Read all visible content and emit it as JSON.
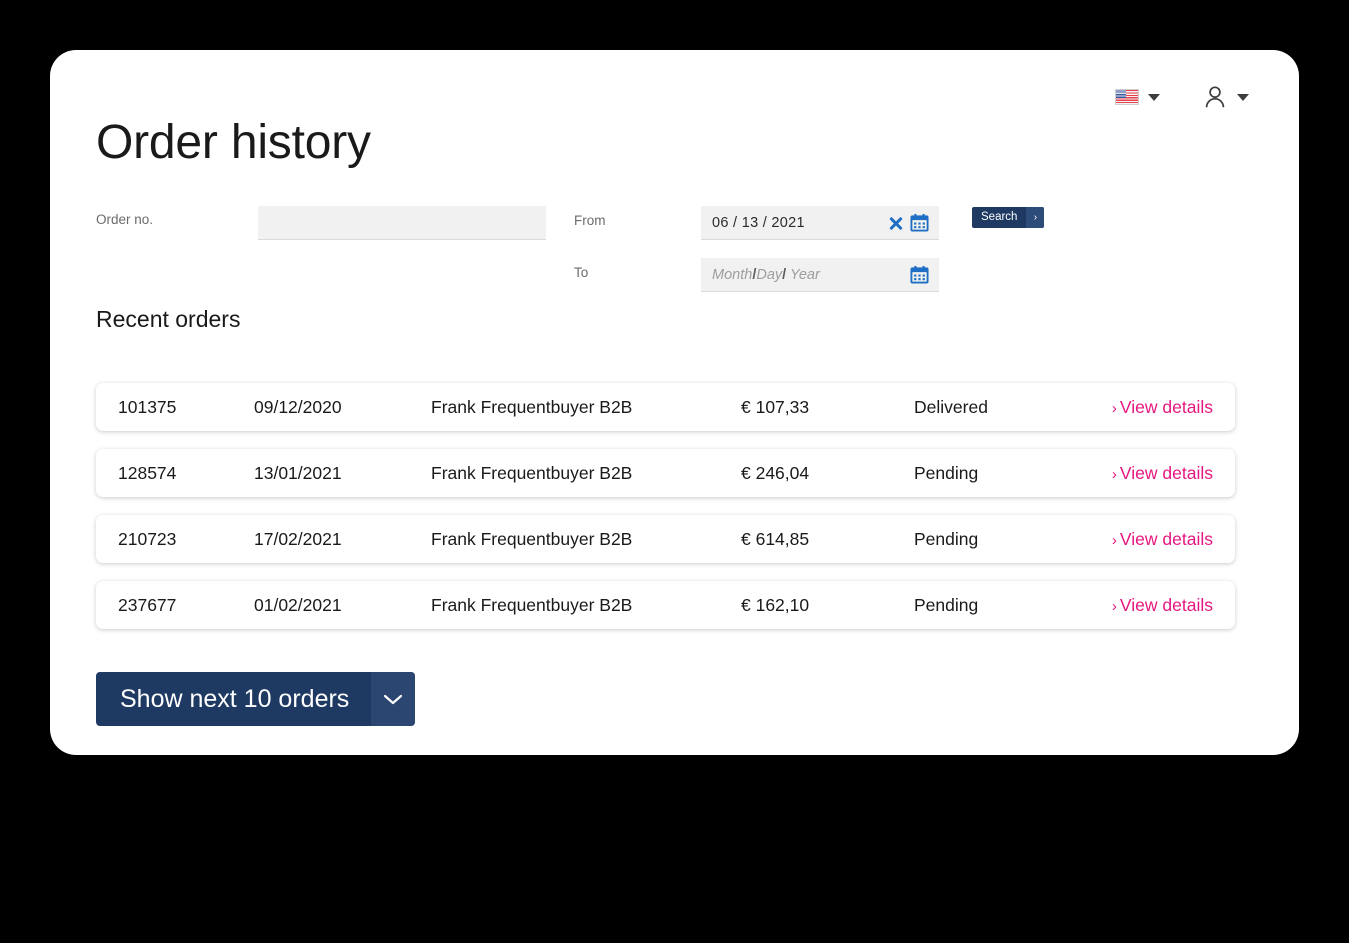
{
  "header": {
    "language_flag": "us-flag-icon",
    "language_caret": "chevron-down-icon",
    "account_icon": "user-icon",
    "account_caret": "chevron-down-icon"
  },
  "page_title": "Order history",
  "search_form": {
    "order_no_label": "Order no.",
    "order_no_value": "",
    "order_no_placeholder": "",
    "from_label": "From",
    "from_value": "06 / 13 / 2021",
    "from_clear_icon": "close-icon",
    "from_calendar_icon": "calendar-icon",
    "to_label": "To",
    "to_placeholder_month": "Month",
    "to_placeholder_sep1": "/",
    "to_placeholder_day": "Day",
    "to_placeholder_sep2": "/",
    "to_placeholder_year": "Year",
    "to_calendar_icon": "calendar-icon",
    "search_button_label": "Search",
    "search_button_arrow": "›"
  },
  "section_title": "Recent orders",
  "orders": [
    {
      "id": "101375",
      "date": "09/12/2020",
      "customer": "Frank Frequentbuyer B2B",
      "amount": "€ 107,33",
      "status": "Delivered",
      "link_label": "View details",
      "link_chevron": "›"
    },
    {
      "id": "128574",
      "date": "13/01/2021",
      "customer": "Frank Frequentbuyer B2B",
      "amount": "€ 246,04",
      "status": "Pending",
      "link_label": "View details",
      "link_chevron": "›"
    },
    {
      "id": "210723",
      "date": "17/02/2021",
      "customer": "Frank Frequentbuyer B2B",
      "amount": "€ 614,85",
      "status": "Pending",
      "link_label": "View details",
      "link_chevron": "›"
    },
    {
      "id": "237677",
      "date": "01/02/2021",
      "customer": "Frank Frequentbuyer B2B",
      "amount": "€ 162,10",
      "status": "Pending",
      "link_label": "View details",
      "link_chevron": "›"
    }
  ],
  "show_more": {
    "label": "Show next 10 orders",
    "caret_icon": "chevron-down-icon"
  },
  "colors": {
    "brand_navy": "#1e3a63",
    "accent_pink": "#e5177f",
    "icon_blue": "#1f6fc4",
    "input_grey": "#f1f1f1",
    "text_dark": "#1a1a1a",
    "label_grey": "#6b6b6b",
    "page_background": "#000000",
    "card_background": "#ffffff"
  }
}
